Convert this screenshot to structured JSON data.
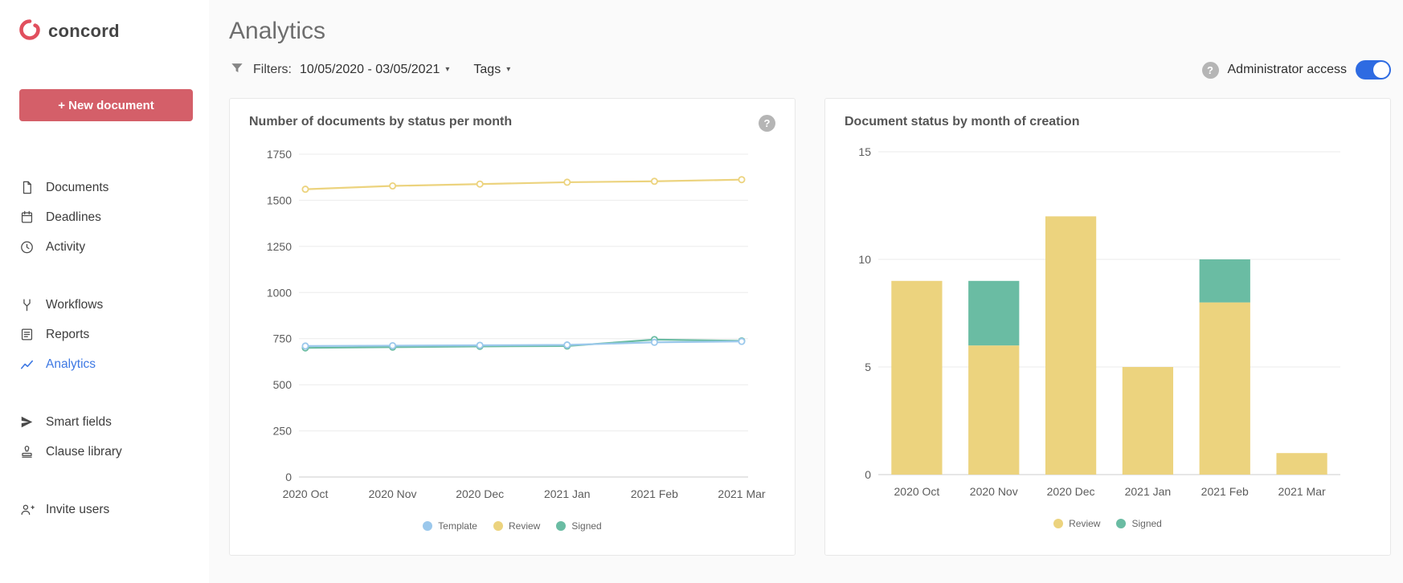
{
  "brand": {
    "name": "concord",
    "logo_color": "#e14f5e"
  },
  "sidebar": {
    "new_document_label": "+ New document",
    "groups": [
      {
        "items": [
          {
            "label": "Documents"
          },
          {
            "label": "Deadlines"
          },
          {
            "label": "Activity"
          }
        ]
      },
      {
        "items": [
          {
            "label": "Workflows"
          },
          {
            "label": "Reports"
          },
          {
            "label": "Analytics",
            "active": true
          }
        ]
      },
      {
        "items": [
          {
            "label": "Smart fields"
          },
          {
            "label": "Clause library"
          }
        ]
      },
      {
        "items": [
          {
            "label": "Invite users"
          }
        ]
      }
    ]
  },
  "header": {
    "title": "Analytics",
    "filters_label": "Filters:",
    "date_range": "10/05/2020 - 03/05/2021",
    "tags_label": "Tags",
    "admin_label": "Administrator access",
    "admin_toggle_on": true,
    "help_glyph": "?",
    "caret_glyph": "▾"
  },
  "colors": {
    "brand_red": "#d45f69",
    "accent_blue": "#3d78e3",
    "template_blue": "#9bc8ec",
    "review_yellow": "#ecd37e",
    "signed_green": "#6abca3",
    "toggle_blue": "#2e6be2"
  },
  "chart_data": [
    {
      "type": "line",
      "title": "Number of documents by status per month",
      "categories": [
        "2020 Oct",
        "2020 Nov",
        "2020 Dec",
        "2021 Jan",
        "2021 Feb",
        "2021 Mar"
      ],
      "series": [
        {
          "name": "Template",
          "color": "#9bc8ec",
          "z": 2,
          "values": [
            710,
            712,
            714,
            716,
            730,
            735
          ]
        },
        {
          "name": "Review",
          "color": "#ecd37e",
          "z": 3,
          "values": [
            1560,
            1578,
            1588,
            1598,
            1603,
            1612
          ]
        },
        {
          "name": "Signed",
          "color": "#6abca3",
          "z": 1,
          "values": [
            700,
            704,
            708,
            710,
            745,
            738
          ]
        }
      ],
      "ylim": [
        0,
        1750
      ],
      "yticks": [
        0,
        250,
        500,
        750,
        1000,
        1250,
        1500,
        1750
      ],
      "grid": true,
      "legend_position": "bottom"
    },
    {
      "type": "bar",
      "stacked": true,
      "title": "Document status by month of creation",
      "categories": [
        "2020 Oct",
        "2020 Nov",
        "2020 Dec",
        "2021 Jan",
        "2021 Feb",
        "2021 Mar"
      ],
      "series": [
        {
          "name": "Review",
          "color": "#ecd37e",
          "values": [
            9,
            6,
            12,
            5,
            8,
            1
          ]
        },
        {
          "name": "Signed",
          "color": "#6abca3",
          "values": [
            0,
            3,
            0,
            0,
            2,
            0
          ]
        }
      ],
      "ylim": [
        0,
        15
      ],
      "yticks": [
        0,
        5,
        10,
        15
      ],
      "grid": true,
      "legend_position": "bottom"
    }
  ]
}
